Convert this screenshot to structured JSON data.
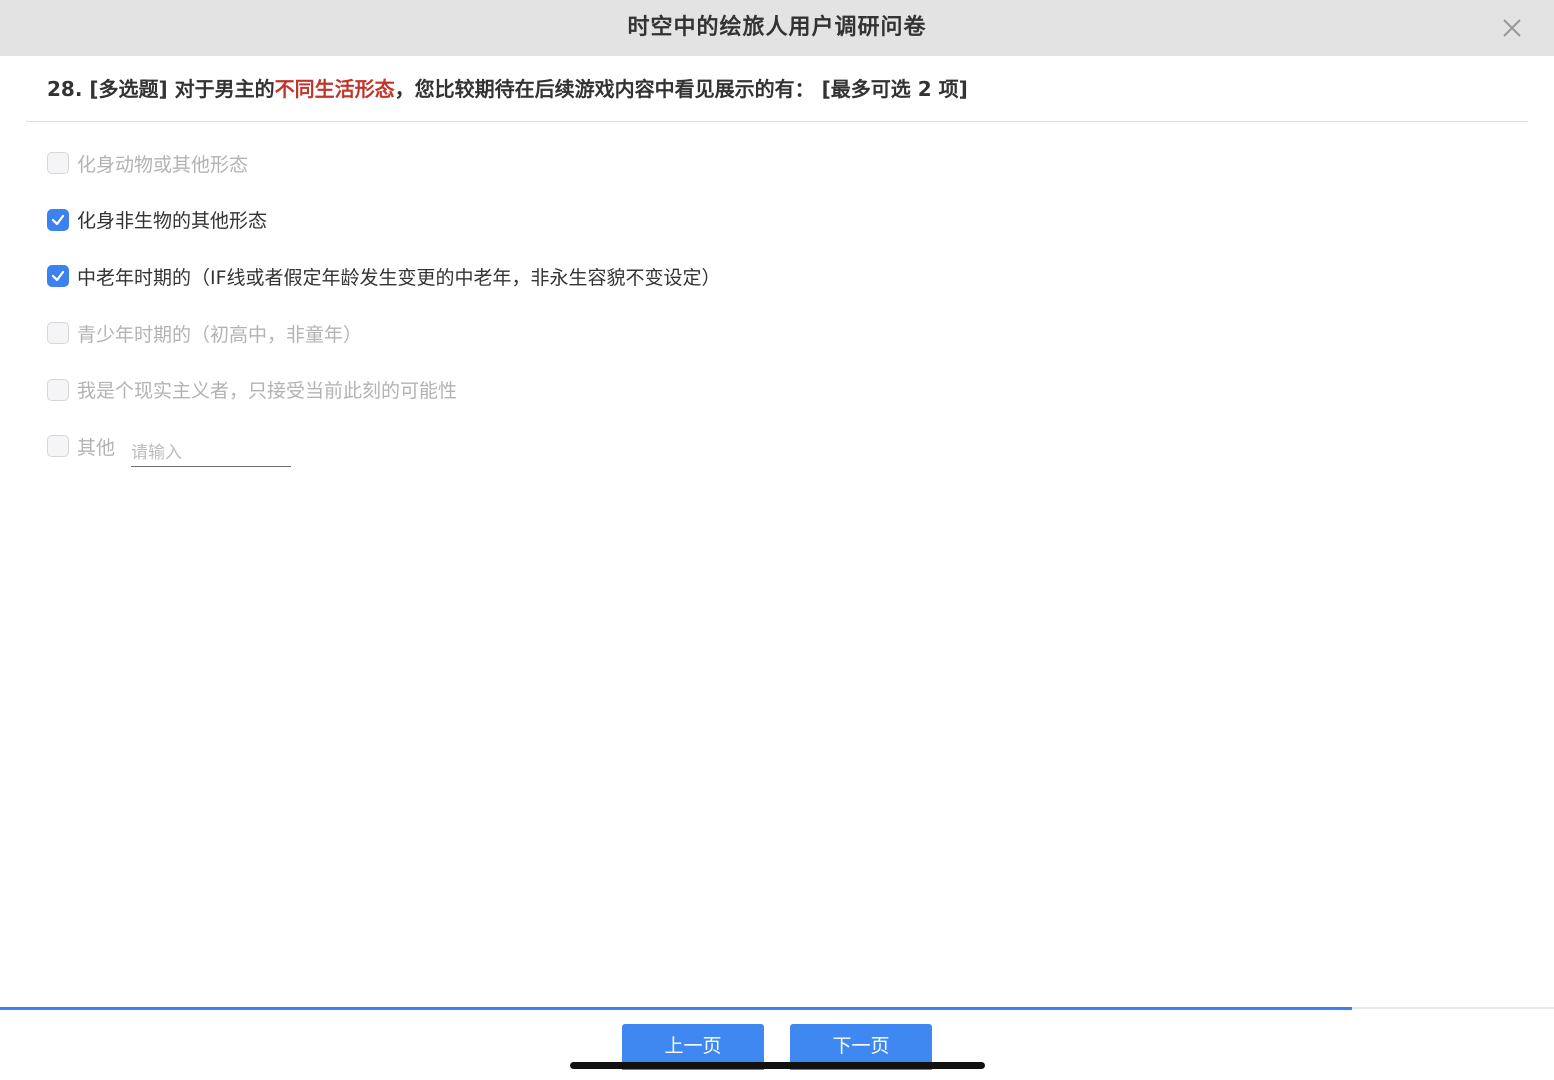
{
  "header": {
    "title": "时空中的绘旅人用户调研问卷"
  },
  "question": {
    "prefix": "28. [多选题] 对于男主的",
    "highlight": "不同生活形态",
    "suffix": "，您比较期待在后续游戏内容中看见展示的有：  [最多可选 2 项]",
    "max_select": 2,
    "highlight_color": "#c0362c"
  },
  "options": [
    {
      "label": "化身动物或其他形态",
      "checked": false,
      "disabled": true
    },
    {
      "label": "化身非生物的其他形态",
      "checked": true,
      "disabled": false
    },
    {
      "label": "中老年时期的（IF线或者假定年龄发生变更的中老年，非永生容貌不变设定）",
      "checked": true,
      "disabled": false
    },
    {
      "label": "青少年时期的（初高中，非童年）",
      "checked": false,
      "disabled": true
    },
    {
      "label": "我是个现实主义者，只接受当前此刻的可能性",
      "checked": false,
      "disabled": true
    },
    {
      "label": "其他",
      "checked": false,
      "disabled": true,
      "placeholder": "请输入"
    }
  ],
  "progress": {
    "fraction": 0.87
  },
  "nav": {
    "prev_label": "上一页",
    "next_label": "下一页"
  },
  "colors": {
    "accent": "#3b82f0",
    "header_bg": "#e3e3e3"
  },
  "icons": {
    "close": "close-icon",
    "check": "check-icon"
  }
}
